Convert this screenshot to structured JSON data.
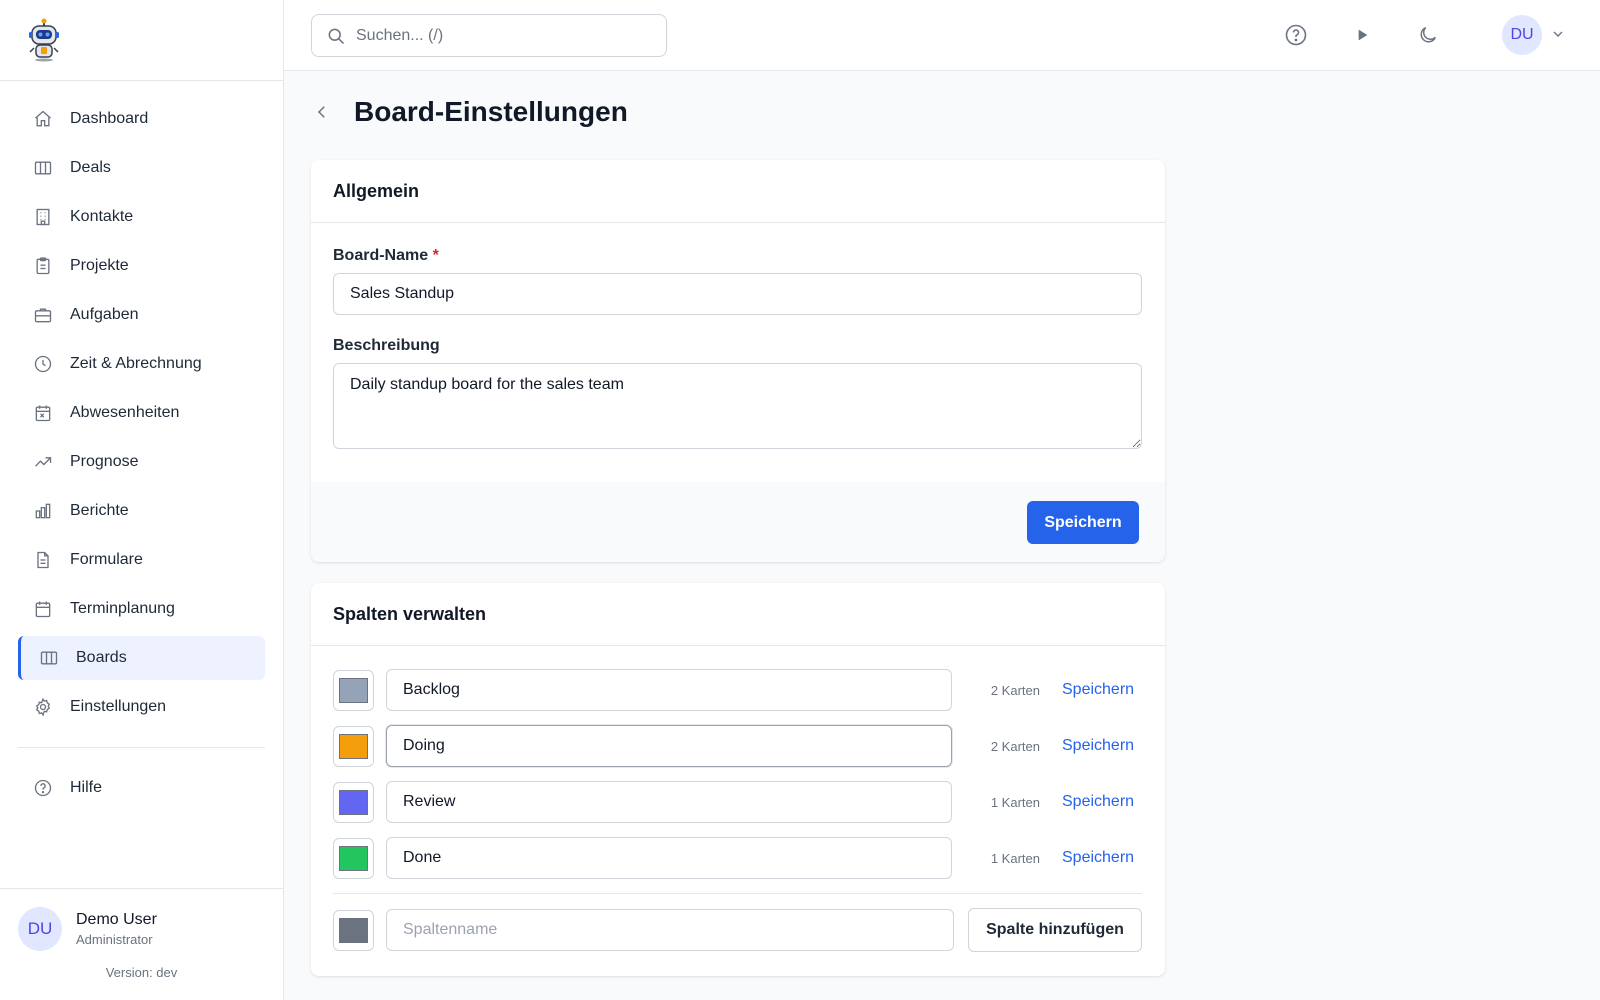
{
  "sidebar": {
    "logo": "robot-logo",
    "items": [
      {
        "label": "Dashboard",
        "icon": "home-icon"
      },
      {
        "label": "Deals",
        "icon": "columns-icon"
      },
      {
        "label": "Kontakte",
        "icon": "building-icon"
      },
      {
        "label": "Projekte",
        "icon": "clipboard-icon"
      },
      {
        "label": "Aufgaben",
        "icon": "briefcase-icon"
      },
      {
        "label": "Zeit & Abrechnung",
        "icon": "clock-icon"
      },
      {
        "label": "Abwesenheiten",
        "icon": "calendar-x-icon"
      },
      {
        "label": "Prognose",
        "icon": "trending-up-icon"
      },
      {
        "label": "Berichte",
        "icon": "bar-chart-icon"
      },
      {
        "label": "Formulare",
        "icon": "document-icon"
      },
      {
        "label": "Terminplanung",
        "icon": "calendar-icon"
      },
      {
        "label": "Boards",
        "icon": "columns-icon",
        "active": true
      },
      {
        "label": "Einstellungen",
        "icon": "gear-icon"
      }
    ],
    "help": {
      "label": "Hilfe",
      "icon": "help-circle-icon"
    },
    "user": {
      "initials": "DU",
      "name": "Demo User",
      "role": "Administrator"
    },
    "version": "Version: dev"
  },
  "header": {
    "search_placeholder": "Suchen... (/)",
    "icons": [
      "help-circle-icon",
      "play-icon",
      "moon-icon"
    ],
    "avatar_initials": "DU"
  },
  "page": {
    "title": "Board-Einstellungen"
  },
  "general": {
    "title": "Allgemein",
    "name_label": "Board-Name",
    "name_required": "*",
    "name_value": "Sales Standup",
    "description_label": "Beschreibung",
    "description_value": "Daily standup board for the sales team",
    "save_label": "Speichern"
  },
  "columns": {
    "title": "Spalten verwalten",
    "items": [
      {
        "name": "Backlog",
        "color": "#94a3b8",
        "count": "2 Karten",
        "save": "Speichern"
      },
      {
        "name": "Doing",
        "color": "#f59e0b",
        "count": "2 Karten",
        "save": "Speichern"
      },
      {
        "name": "Review",
        "color": "#6366f1",
        "count": "1 Karten",
        "save": "Speichern"
      },
      {
        "name": "Done",
        "color": "#22c55e",
        "count": "1 Karten",
        "save": "Speichern"
      }
    ],
    "new_color": "#6b7280",
    "new_placeholder": "Spaltenname",
    "add_label": "Spalte hinzufügen"
  },
  "colors": {
    "accent": "#2563eb",
    "active_bg": "#eef2ff",
    "avatar_bg": "#e0e7ff",
    "avatar_text": "#4f46e5"
  }
}
